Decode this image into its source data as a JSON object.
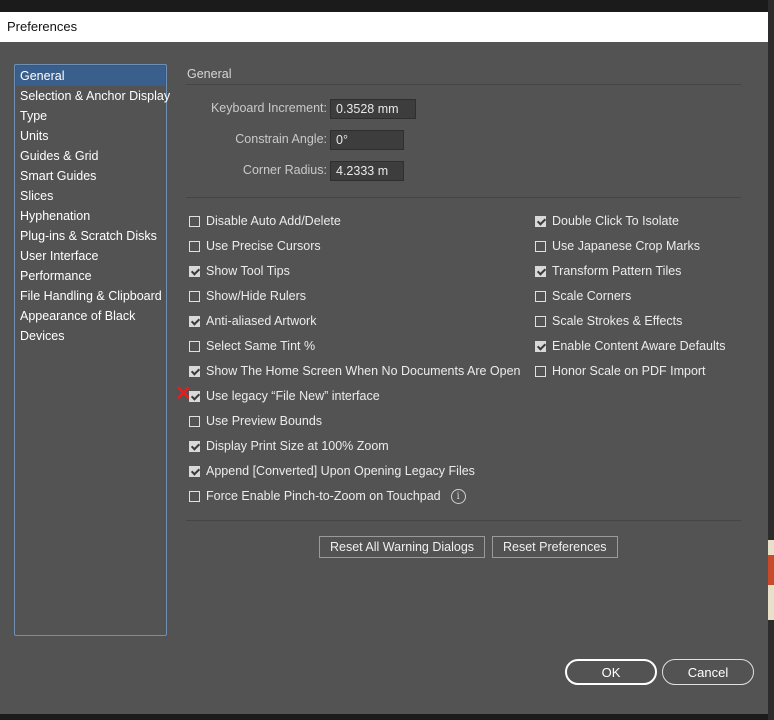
{
  "window": {
    "title": "Preferences"
  },
  "sidebar": {
    "items": [
      {
        "label": "General",
        "selected": true
      },
      {
        "label": "Selection & Anchor Display"
      },
      {
        "label": "Type"
      },
      {
        "label": "Units"
      },
      {
        "label": "Guides & Grid"
      },
      {
        "label": "Smart Guides"
      },
      {
        "label": "Slices"
      },
      {
        "label": "Hyphenation"
      },
      {
        "label": "Plug-ins & Scratch Disks"
      },
      {
        "label": "User Interface"
      },
      {
        "label": "Performance"
      },
      {
        "label": "File Handling & Clipboard"
      },
      {
        "label": "Appearance of Black"
      },
      {
        "label": "Devices"
      }
    ]
  },
  "general": {
    "section_title": "General",
    "fields": {
      "keyboard_increment": {
        "label": "Keyboard Increment:",
        "value": "0.3528 mm"
      },
      "constrain_angle": {
        "label": "Constrain Angle:",
        "value": "0°"
      },
      "corner_radius": {
        "label": "Corner Radius:",
        "value": "4.2333 m"
      }
    },
    "left_options": [
      {
        "label": "Disable Auto Add/Delete",
        "checked": false
      },
      {
        "label": "Use Precise Cursors",
        "checked": false
      },
      {
        "label": "Show Tool Tips",
        "checked": true
      },
      {
        "label": "Show/Hide Rulers",
        "checked": false
      },
      {
        "label": "Anti-aliased Artwork",
        "checked": true
      },
      {
        "label": "Select Same Tint %",
        "checked": false
      },
      {
        "label": "Show The Home Screen When No Documents Are Open",
        "checked": true
      },
      {
        "label": "Use legacy “File New” interface",
        "checked": true,
        "marker": "✕"
      },
      {
        "label": "Use Preview Bounds",
        "checked": false
      },
      {
        "label": "Display Print Size at 100% Zoom",
        "checked": true
      },
      {
        "label": "Append [Converted] Upon Opening Legacy Files",
        "checked": true
      },
      {
        "label": "Force Enable Pinch-to-Zoom on Touchpad",
        "checked": false,
        "info_icon": "i"
      }
    ],
    "right_options": [
      {
        "label": "Double Click To Isolate",
        "checked": true
      },
      {
        "label": "Use Japanese Crop Marks",
        "checked": false
      },
      {
        "label": "Transform Pattern Tiles",
        "checked": true
      },
      {
        "label": "Scale Corners",
        "checked": false
      },
      {
        "label": "Scale Strokes & Effects",
        "checked": false
      },
      {
        "label": "Enable Content Aware Defaults",
        "checked": true
      },
      {
        "label": "Honor Scale on PDF Import",
        "checked": false
      }
    ],
    "buttons": {
      "reset_warnings": "Reset All Warning Dialogs",
      "reset_prefs": "Reset Preferences"
    }
  },
  "footer": {
    "ok_label": "OK",
    "cancel_label": "Cancel"
  },
  "colors": {
    "accent_selection": "#3a5f8c",
    "dialog_bg": "#535353",
    "marker_red": "#e02020"
  }
}
